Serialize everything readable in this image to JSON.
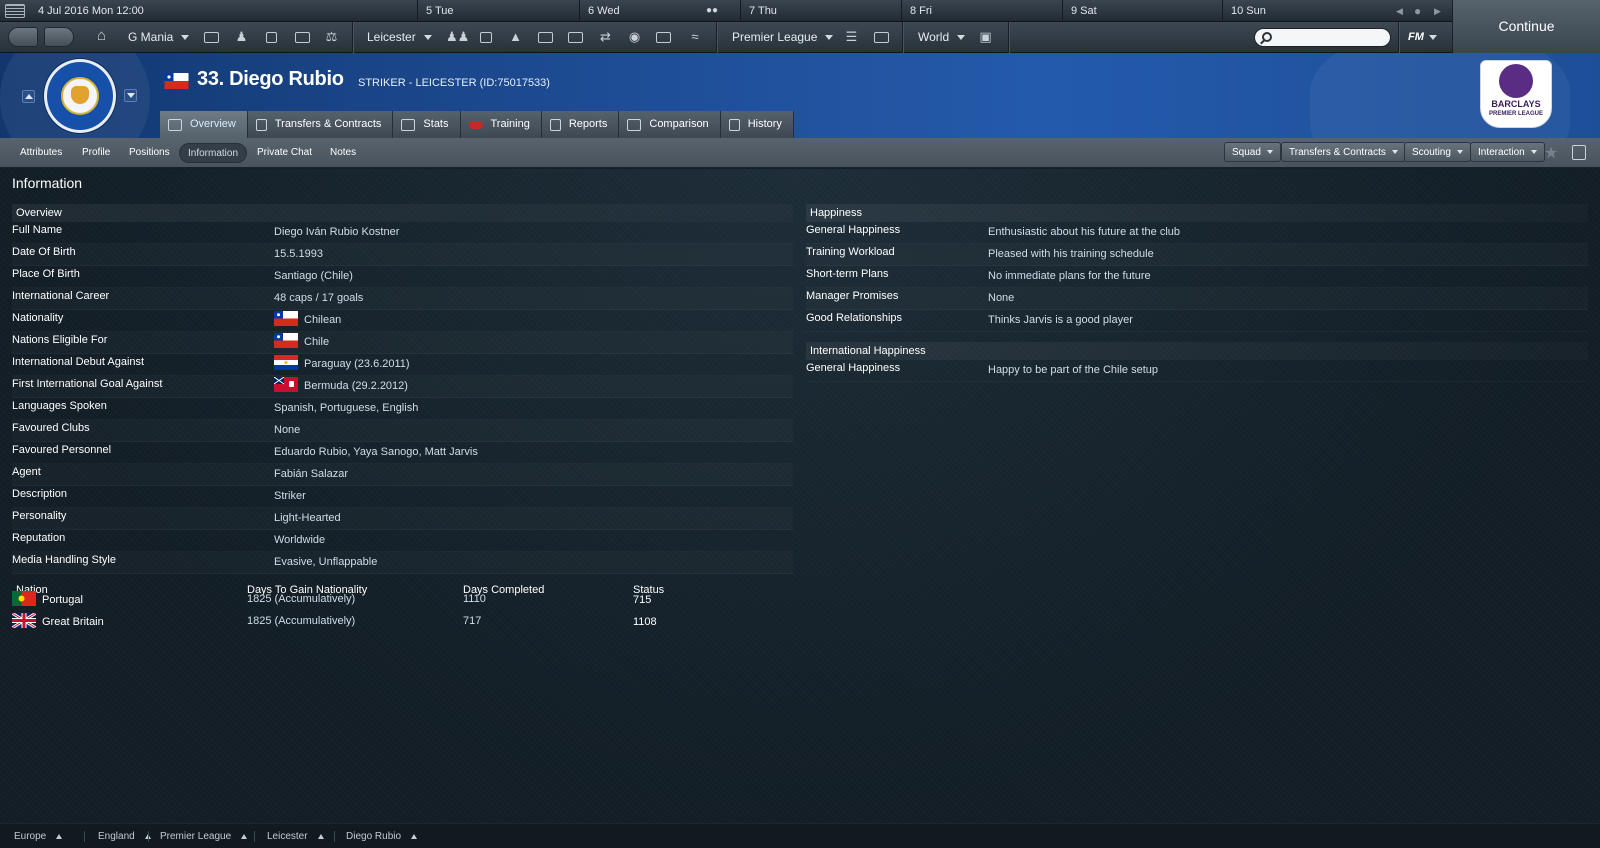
{
  "calendar": {
    "current": "4 Jul 2016  Mon 12:00",
    "days": [
      "5  Tue",
      "6  Wed",
      "7  Thu",
      "8  Fri",
      "9  Sat",
      "10  Sun"
    ]
  },
  "toolbar": {
    "manager": "G Mania",
    "club": "Leicester",
    "competition": "Premier League",
    "world": "World",
    "fm_label": "FM",
    "search_placeholder": ""
  },
  "continue_label": "Continue",
  "header": {
    "player_name": "33. Diego Rubio",
    "player_sub": "STRIKER - LEICESTER (ID:75017533)",
    "pl_logo_text": "BARCLAYS",
    "pl_logo_sub": "PREMIER LEAGUE"
  },
  "tabs": [
    "Overview",
    "Transfers & Contracts",
    "Stats",
    "Training",
    "Reports",
    "Comparison",
    "History"
  ],
  "subtabs": [
    "Attributes",
    "Profile",
    "Positions",
    "Information",
    "Private Chat",
    "Notes"
  ],
  "right_buttons": [
    "Squad",
    "Transfers & Contracts",
    "Scouting",
    "Interaction"
  ],
  "page_title": "Information",
  "overview": {
    "title": "Overview",
    "rows": [
      {
        "label": "Full Name",
        "value": "Diego Iván Rubio Kostner"
      },
      {
        "label": "Date Of Birth",
        "value": "15.5.1993"
      },
      {
        "label": "Place Of Birth",
        "value": "Santiago (Chile)"
      },
      {
        "label": "International Career",
        "value": "48 caps / 17 goals"
      },
      {
        "label": "Nationality",
        "value": "Chilean"
      },
      {
        "label": "Nations Eligible For",
        "value": "Chile"
      },
      {
        "label": "International Debut Against",
        "value": "Paraguay (23.6.2011)"
      },
      {
        "label": "First International Goal Against",
        "value": "Bermuda (29.2.2012)"
      },
      {
        "label": "Languages Spoken",
        "value": "Spanish, Portuguese, English"
      },
      {
        "label": "Favoured Clubs",
        "value": "None"
      },
      {
        "label": "Favoured Personnel",
        "value": "Eduardo Rubio, Yaya Sanogo, Matt Jarvis"
      },
      {
        "label": "Agent",
        "value": "Fabián Salazar"
      },
      {
        "label": "Description",
        "value": "Striker"
      },
      {
        "label": "Personality",
        "value": "Light-Hearted"
      },
      {
        "label": "Reputation",
        "value": "Worldwide"
      },
      {
        "label": "Media Handling Style",
        "value": "Evasive, Unflappable"
      }
    ]
  },
  "nationality_table": {
    "headers": [
      "Nation",
      "Days To Gain Nationality",
      "Days Completed",
      "Status"
    ],
    "rows": [
      {
        "nation": "Portugal",
        "days_to_gain": "1825 (Accumulatively)",
        "completed": "1110",
        "status": "715"
      },
      {
        "nation": "Great Britain",
        "days_to_gain": "1825 (Accumulatively)",
        "completed": "717",
        "status": "1108"
      }
    ]
  },
  "happiness": {
    "title": "Happiness",
    "rows": [
      {
        "label": "General Happiness",
        "value": "Enthusiastic about his future at the club"
      },
      {
        "label": "Training Workload",
        "value": "Pleased with his training schedule"
      },
      {
        "label": "Short-term Plans",
        "value": "No immediate plans for the future"
      },
      {
        "label": "Manager Promises",
        "value": "None"
      },
      {
        "label": "Good Relationships",
        "value": "Thinks Jarvis is a good player"
      }
    ]
  },
  "intl_happiness": {
    "title": "International Happiness",
    "rows": [
      {
        "label": "General Happiness",
        "value": "Happy to be part of the Chile setup"
      }
    ]
  },
  "breadcrumbs": [
    "Europe",
    "England",
    "Premier League",
    "Leicester",
    "Diego Rubio"
  ],
  "colors": {
    "banner_blue": "#1d4b92",
    "content_bg": "#132029",
    "accent_text": "#d1dde8"
  }
}
